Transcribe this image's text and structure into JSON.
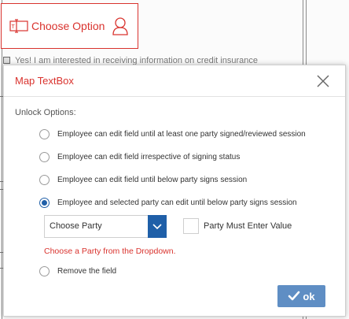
{
  "background": {
    "consent_text": "Yes! I am interested in receiving information on credit insurance"
  },
  "choose_option": {
    "label": "Choose Option"
  },
  "modal": {
    "title": "Map TextBox",
    "unlock_title": "Unlock Options:",
    "options": [
      "Employee can edit field until at least one party signed/reviewed session",
      "Employee can edit field irrespective of signing status",
      "Employee can edit field until below party signs session",
      "Employee and selected party can edit until below party signs session",
      "Remove the field"
    ],
    "selected_option_index": 3,
    "party_select": {
      "value": "Choose Party"
    },
    "must_enter_label": "Party Must Enter Value",
    "must_enter_checked": false,
    "error": "Choose a Party from the Dropdown.",
    "ok_label": "ok"
  },
  "colors": {
    "accent_red": "#d9332e",
    "primary_blue": "#1f5fa8",
    "ok_button": "#5f8ec4"
  }
}
